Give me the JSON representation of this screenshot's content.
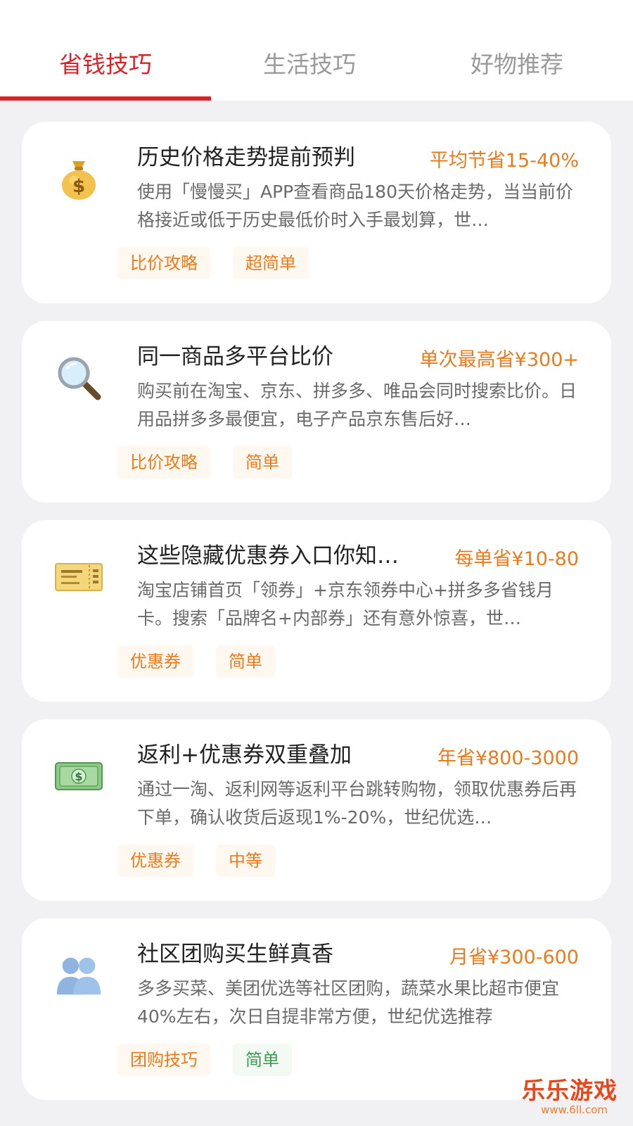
{
  "tabs": [
    {
      "label": "省钱技巧",
      "active": true
    },
    {
      "label": "生活技巧",
      "active": false
    },
    {
      "label": "好物推荐",
      "active": false
    }
  ],
  "colors": {
    "accent": "#d8232a",
    "badge": "#e87b1c",
    "tag_green": "#3a9a52",
    "background": "#f1f1f4"
  },
  "cards": [
    {
      "icon": "money-bag-icon",
      "title": "历史价格走势提前预判",
      "badge": "平均节省15-40%",
      "desc": "使用「慢慢买」APP查看商品180天价格走势，当当前价格接近或低于历史最低价时入手最划算，世…",
      "tags": [
        "比价攻略",
        "超简单"
      ]
    },
    {
      "icon": "magnifier-icon",
      "title": "同一商品多平台比价",
      "badge": "单次最高省¥300+",
      "desc": "购买前在淘宝、京东、拼多多、唯品会同时搜索比价。日用品拼多多最便宜，电子产品京东售后好…",
      "tags": [
        "比价攻略",
        "简单"
      ]
    },
    {
      "icon": "ticket-icon",
      "title": "这些隐藏优惠券入口你知…",
      "badge": "每单省¥10-80",
      "desc": "淘宝店铺首页「领券」+京东领券中心+拼多多省钱月卡。搜索「品牌名+内部券」还有意外惊喜，世…",
      "tags": [
        "优惠券",
        "简单"
      ]
    },
    {
      "icon": "dollar-bill-icon",
      "title": "返利+优惠券双重叠加",
      "badge": "年省¥800-3000",
      "desc": "通过一淘、返利网等返利平台跳转购物，领取优惠券后再下单，确认收货后返现1%-20%，世纪优选…",
      "tags": [
        "优惠券",
        "中等"
      ]
    },
    {
      "icon": "group-people-icon",
      "title": "社区团购买生鲜真香",
      "badge": "月省¥300-600",
      "desc": "多多买菜、美团优选等社区团购，蔬菜水果比超市便宜40%左右，次日自提非常方便，世纪优选推荐",
      "tags": [
        "团购技巧",
        "简单"
      ]
    }
  ],
  "watermark": {
    "main": "乐乐游戏",
    "sub": "www.6ll.com"
  }
}
